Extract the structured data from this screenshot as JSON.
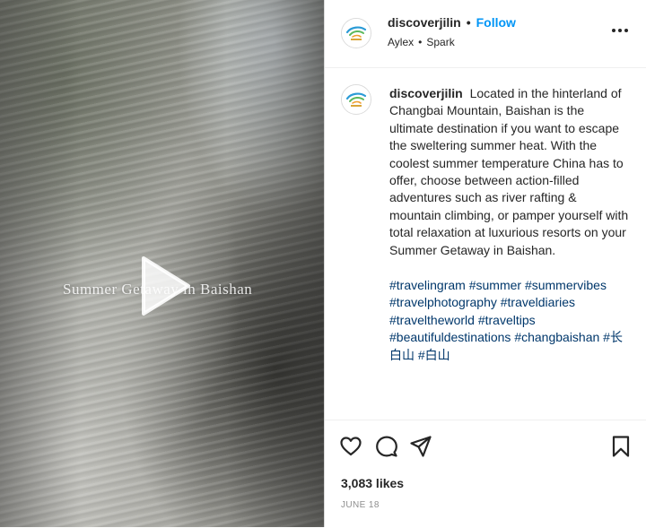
{
  "video": {
    "caption_overlay": "Summer Getaway in Baishan",
    "play_icon": "play-icon"
  },
  "header": {
    "username": "discoverjilin",
    "separator": "•",
    "follow_label": "Follow",
    "audio_artist": "Aylex",
    "audio_separator": "•",
    "audio_track": "Spark",
    "more_icon": "more-horizontal-icon"
  },
  "post": {
    "username": "discoverjilin",
    "caption": "Located in the hinterland of Changbai Mountain, Baishan is the ultimate destination if you want to escape the sweltering summer heat. With the coolest summer temperature China has to offer, choose between action-filled adventures such as river rafting & mountain climbing, or pamper yourself with total relaxation at luxurious resorts on your Summer Getaway in Baishan.",
    "hashtags": "#travelingram #summer #summervibes #travelphotography #traveldiaries #traveltheworld #traveltips #beautifuldestinations #changbaishan #长白山 #白山"
  },
  "actions": {
    "icons": [
      "heart-icon",
      "comment-icon",
      "share-icon",
      "bookmark-icon"
    ],
    "likes": "3,083 likes",
    "date": "JUNE 18"
  },
  "colors": {
    "link_blue": "#0095f6",
    "hashtag_blue": "#00376b",
    "text": "#262626",
    "muted": "#8e8e8e"
  }
}
